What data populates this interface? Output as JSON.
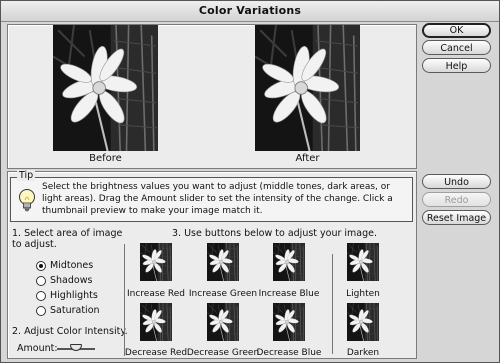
{
  "window": {
    "title": "Color Variations"
  },
  "preview": {
    "before_label": "Before",
    "after_label": "After"
  },
  "buttons": {
    "ok": "OK",
    "cancel": "Cancel",
    "help": "Help",
    "undo": "Undo",
    "redo": "Redo",
    "reset": "Reset Image"
  },
  "tip": {
    "label": "Tip",
    "text": "Select the brightness values you want to adjust (middle tones, dark areas, or light areas). Drag the Amount slider to set the intensity of the change. Click a thumbnail preview to make your image match it."
  },
  "step1": {
    "label": "1. Select area of image to adjust.",
    "options": [
      {
        "label": "Midtones",
        "selected": true
      },
      {
        "label": "Shadows",
        "selected": false
      },
      {
        "label": "Highlights",
        "selected": false
      },
      {
        "label": "Saturation",
        "selected": false
      }
    ]
  },
  "step2": {
    "label": "2. Adjust Color Intensity.",
    "amount_label": "Amount:",
    "amount_fraction": 0.5
  },
  "step3": {
    "label": "3. Use buttons below to adjust your image.",
    "variations": [
      {
        "label": "Increase Red"
      },
      {
        "label": "Increase Green"
      },
      {
        "label": "Increase Blue"
      },
      {
        "label": "Lighten"
      },
      {
        "label": "Decrease Red"
      },
      {
        "label": "Decrease Green"
      },
      {
        "label": "Decrease Blue"
      },
      {
        "label": "Darken"
      }
    ]
  },
  "icons": [
    "lightbulb-icon"
  ]
}
